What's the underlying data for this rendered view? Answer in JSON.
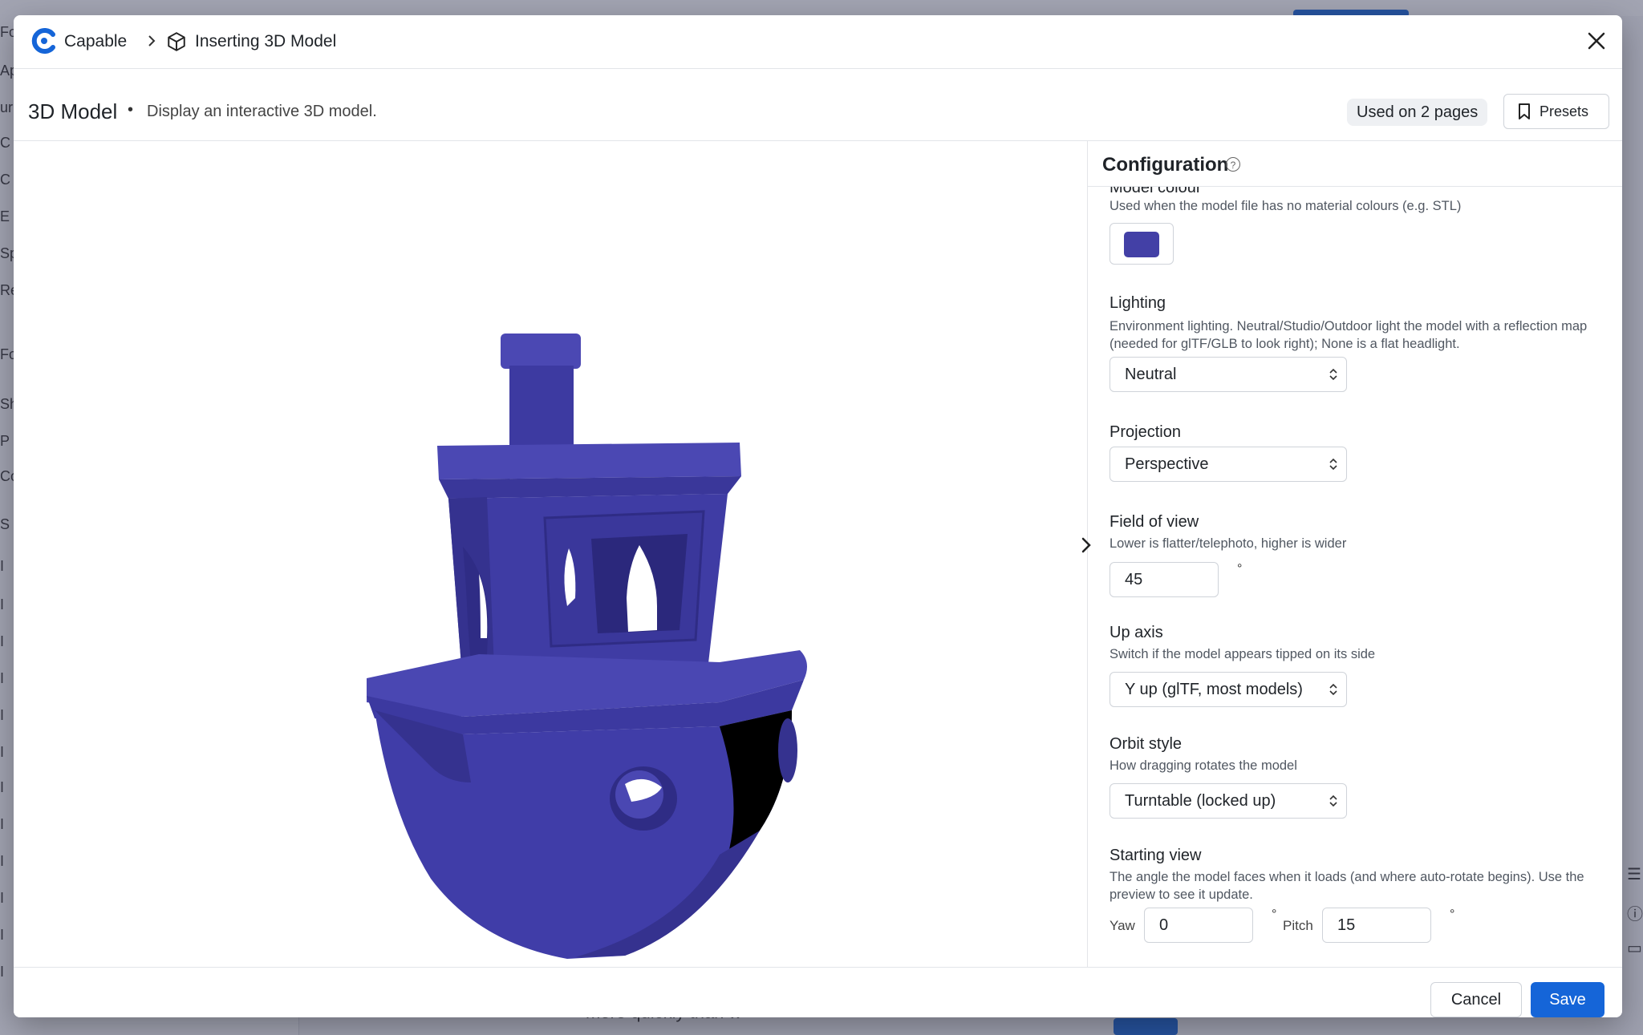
{
  "background": {
    "left_letters": [
      "Fo",
      "Ap",
      "ur",
      "C",
      "C",
      "E",
      "Sp",
      "Re",
      "Fo",
      "Sh",
      "P",
      "Co",
      "S",
      "I",
      "I",
      "I",
      "I",
      "I",
      "I",
      "I",
      "I",
      "I",
      "I",
      "I",
      "I"
    ],
    "bottom_text": "more quickly than w"
  },
  "header": {
    "brand": "Capable",
    "breadcrumb_title": "Inserting 3D Model"
  },
  "subheader": {
    "title": "3D Model",
    "separator": "•",
    "description": "Display an interactive 3D model.",
    "used_badge": "Used on 2 pages",
    "presets_label": "Presets"
  },
  "config": {
    "title": "Configuration",
    "model_colour": {
      "label": "Model colour",
      "description": "Used when the model file has no material colours (e.g. STL)",
      "value": "#4340a6"
    },
    "lighting": {
      "label": "Lighting",
      "description": "Environment lighting. Neutral/Studio/Outdoor light the model with a reflection map (needed for glTF/GLB to look right); None is a flat headlight.",
      "value": "Neutral"
    },
    "projection": {
      "label": "Projection",
      "value": "Perspective"
    },
    "field_of_view": {
      "label": "Field of view",
      "description": "Lower is flatter/telephoto, higher is wider",
      "value": "45",
      "unit": "°"
    },
    "up_axis": {
      "label": "Up axis",
      "description": "Switch if the model appears tipped on its side",
      "value": "Y up (glTF, most models)"
    },
    "orbit_style": {
      "label": "Orbit style",
      "description": "How dragging rotates the model",
      "value": "Turntable (locked up)"
    },
    "starting_view": {
      "label": "Starting view",
      "description": "The angle the model faces when it loads (and where auto-rotate begins). Use the preview to see it update.",
      "yaw_label": "Yaw",
      "yaw_value": "0",
      "pitch_label": "Pitch",
      "pitch_value": "15",
      "unit": "°"
    }
  },
  "footer": {
    "cancel_label": "Cancel",
    "save_label": "Save"
  },
  "colors": {
    "accent": "#1565d8",
    "model": "#4340a6",
    "model_shadow": "#2f2c85",
    "model_highlight": "#5a57c0"
  }
}
